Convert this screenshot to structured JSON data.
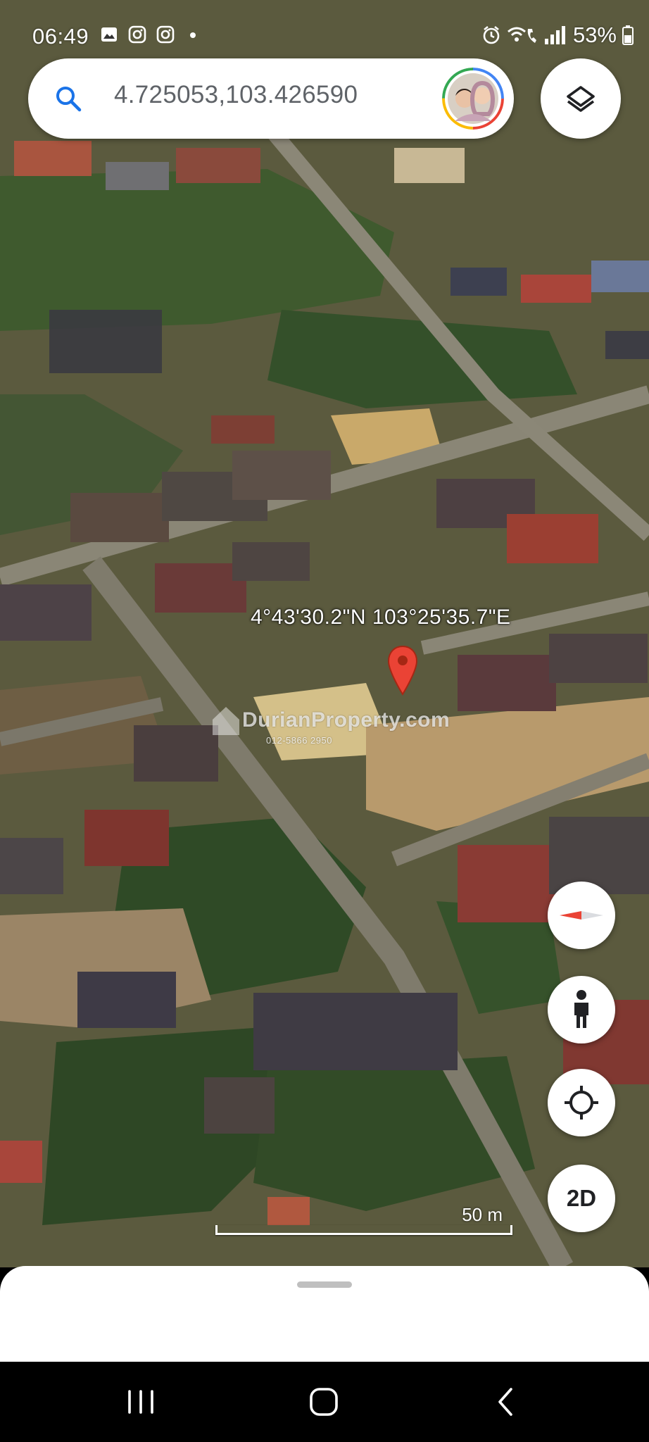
{
  "status_bar": {
    "time": "06:49",
    "battery": "53%",
    "left_icons": [
      "gallery-icon",
      "instagram-icon",
      "instagram-icon",
      "dot-icon"
    ],
    "right_icons": [
      "alarm-icon",
      "wifi-calling-icon",
      "signal-icon",
      "battery-icon"
    ]
  },
  "search": {
    "value": "4.725053,103.426590"
  },
  "map": {
    "coordinates_label": "4°43'30.2\"N 103°25'35.7\"E",
    "watermark": "DurianProperty.com",
    "watermark_sub": "012-5866 2950",
    "scale_label": "50 m"
  },
  "controls": {
    "mode_label": "2D"
  },
  "colors": {
    "pin": "#EA4335",
    "compass_north": "#EA4335"
  }
}
